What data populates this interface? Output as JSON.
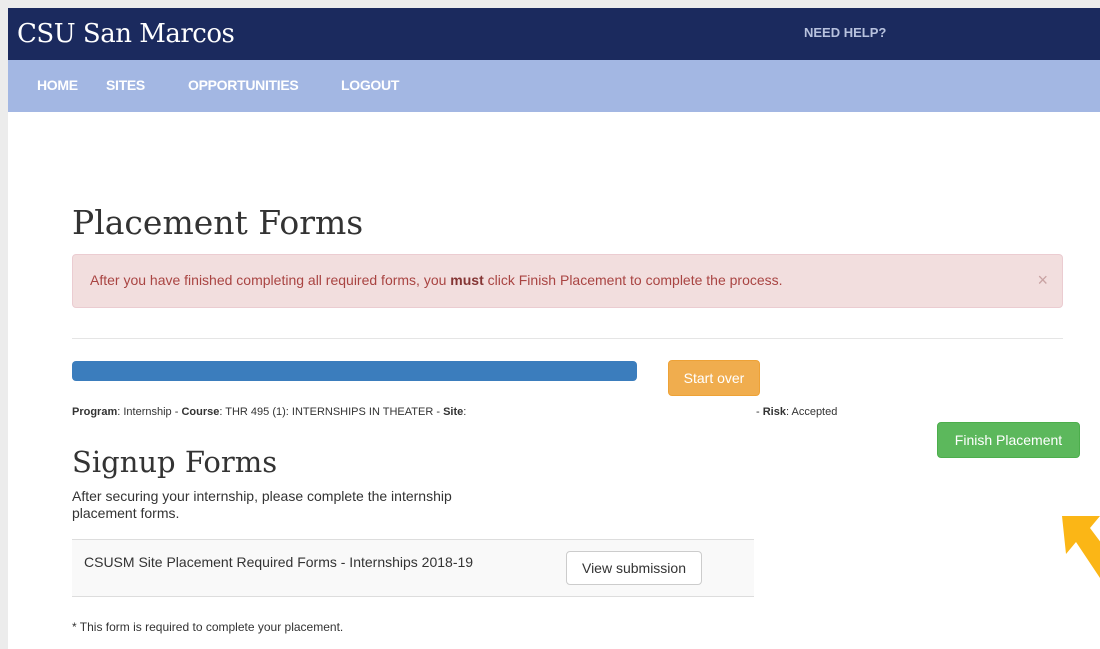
{
  "header": {
    "brand": "CSU San Marcos",
    "help_label": "NEED HELP?"
  },
  "nav": {
    "items": [
      {
        "label": "HOME"
      },
      {
        "label": "SITES"
      },
      {
        "label": "OPPORTUNITIES"
      },
      {
        "label": "LOGOUT"
      }
    ]
  },
  "page": {
    "title": "Placement Forms"
  },
  "alert": {
    "text_before": "After you have finished completing all required forms, you ",
    "text_bold": "must",
    "text_after": " click Finish Placement to complete the process.",
    "close_glyph": "×"
  },
  "progress": {
    "fraction": 1.0
  },
  "buttons": {
    "start_over": "Start over",
    "finish_placement": "Finish Placement",
    "view_submission": "View submission"
  },
  "meta": {
    "program_label": "Program",
    "program_value": ": Internship - ",
    "course_label": "Course",
    "course_value": ": THR 495 (1): INTERNSHIPS IN THEATER - ",
    "site_label": "Site",
    "site_value": ":",
    "risk_prefix": "- ",
    "risk_label": "Risk",
    "risk_value": ": Accepted"
  },
  "signup": {
    "title": "Signup Forms",
    "description": "After securing your internship, please complete the internship placement forms.",
    "forms": [
      {
        "name": "CSUSM Site Placement Required Forms - Internships 2018-19"
      }
    ],
    "footnote": "* This form is required to complete your placement."
  },
  "colors": {
    "header_bg": "#1b2a5e",
    "nav_bg": "#a3b7e3",
    "progress": "#3b7dbd",
    "warning": "#f0ad4e",
    "success": "#5cb85c",
    "alert_bg": "#f2dede",
    "arrow": "#fbb616"
  },
  "icons": {
    "close": "close-icon",
    "annotation_arrow": "arrow-icon"
  }
}
